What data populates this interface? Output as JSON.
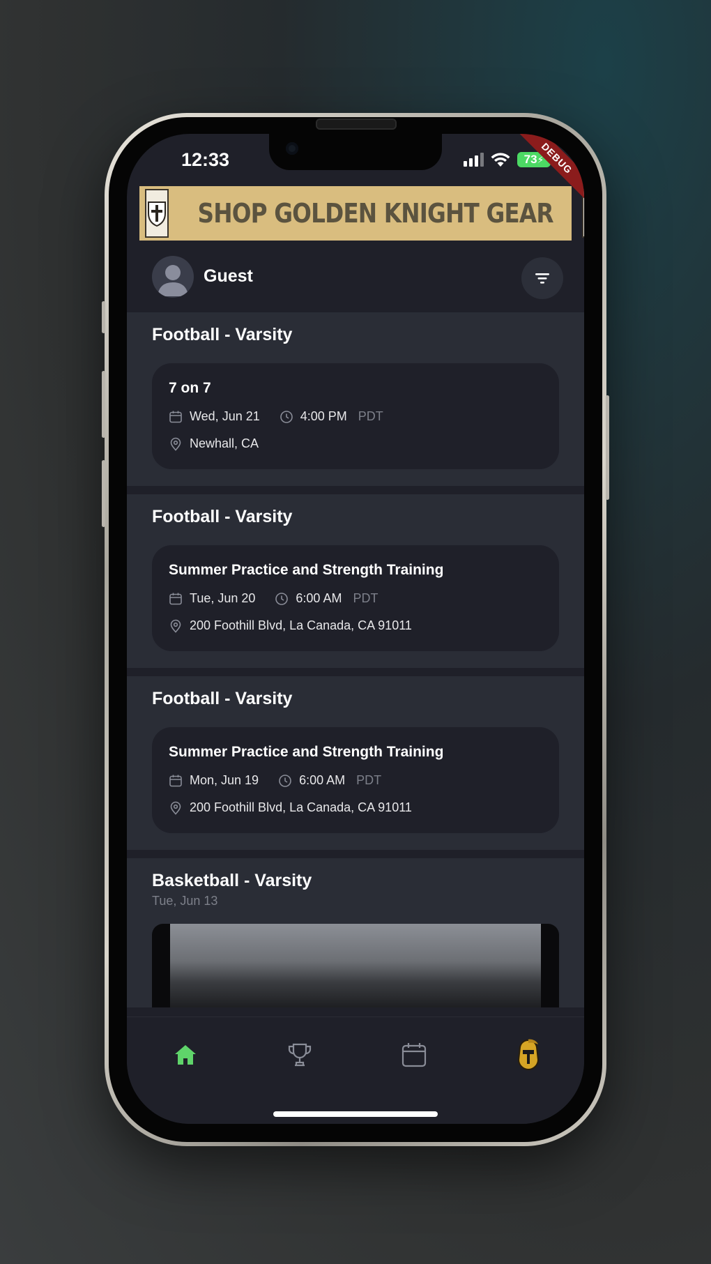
{
  "status": {
    "time": "12:33",
    "battery": "73"
  },
  "debug": "DEBUG",
  "banner": {
    "text": "SHOP GOLDEN KNIGHT GEAR"
  },
  "user": {
    "name": "Guest"
  },
  "feed": [
    {
      "team": "Football - Varsity",
      "title": "7 on 7",
      "date": "Wed, Jun 21",
      "time": "4:00 PM",
      "tz": "PDT",
      "location": "Newhall, CA"
    },
    {
      "team": "Football - Varsity",
      "title": "Summer Practice and Strength Training",
      "date": "Tue, Jun 20",
      "time": "6:00 AM",
      "tz": "PDT",
      "location": "200 Foothill Blvd, La Canada, CA 91011"
    },
    {
      "team": "Football - Varsity",
      "title": "Summer Practice and Strength Training",
      "date": "Mon, Jun 19",
      "time": "6:00 AM",
      "tz": "PDT",
      "location": "200 Foothill Blvd, La Canada, CA 91011"
    },
    {
      "team": "Basketball - Varsity",
      "subtitle": "Tue, Jun 13"
    }
  ],
  "tabs": [
    {
      "icon": "home-icon",
      "active": true
    },
    {
      "icon": "trophy-icon",
      "active": false
    },
    {
      "icon": "calendar-icon",
      "active": false
    },
    {
      "icon": "knight-helmet-icon",
      "active": false
    }
  ],
  "colors": {
    "accent": "#5fd46a",
    "background": "#1f2029",
    "section": "#2a2d36",
    "banner": "#d9bd7f"
  }
}
